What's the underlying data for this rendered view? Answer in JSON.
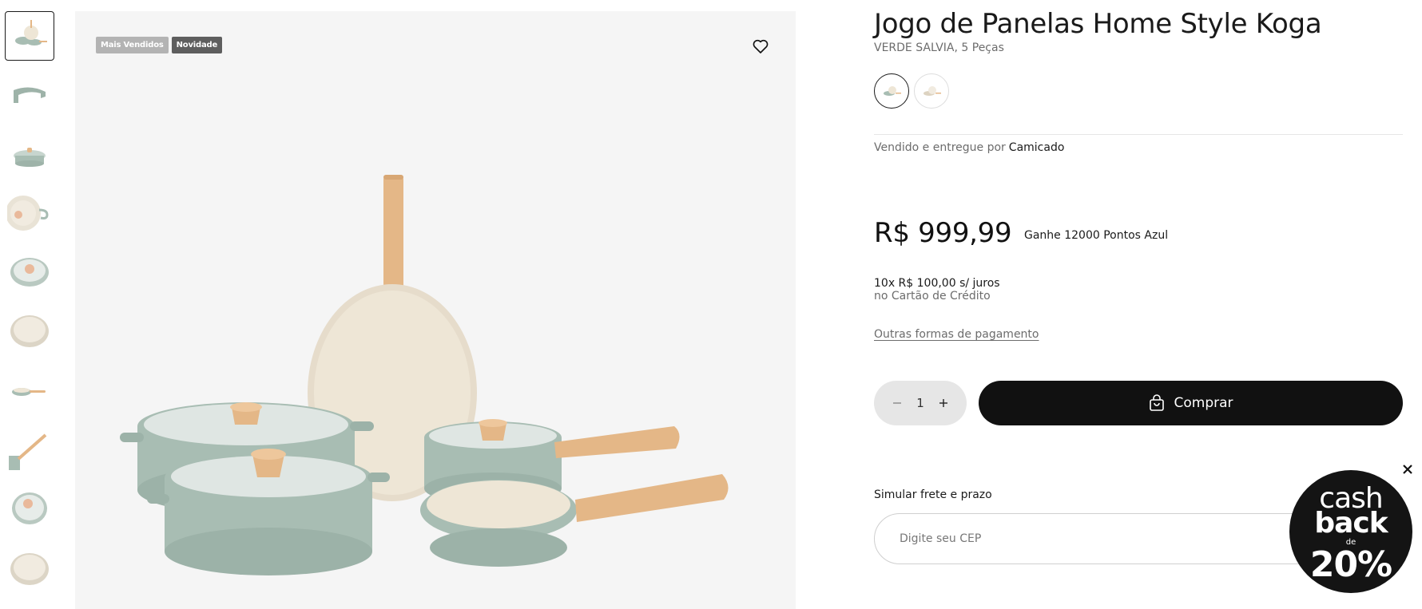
{
  "badges": [
    "Mais Vendidos",
    "Novidade"
  ],
  "product": {
    "title": "Jogo de Panelas Home Style Koga",
    "subtitle": "VERDE SALVIA, 5 Peças",
    "seller_prefix": "Vendido e entregue por",
    "seller_name": "Camicado",
    "price": "R$ 999,99",
    "points": "Ganhe 12000 Pontos Azul",
    "installments_line1": "10x R$ 100,00 s/ juros",
    "installments_line2": "no Cartão de Crédito",
    "other_payments": "Outras formas de pagamento"
  },
  "quantity": {
    "value": "1"
  },
  "buy_button": {
    "label": "Comprar"
  },
  "shipping": {
    "label": "Simular frete e prazo",
    "placeholder": "Digite seu CEP"
  },
  "cashback": {
    "line1": "cash",
    "line2": "back",
    "line3": "de",
    "line4": "20%"
  },
  "colors": {
    "accent": "#111111",
    "pot_green": "#a8bdb3",
    "pot_cream": "#eee6d6",
    "wood": "#e4b787"
  }
}
